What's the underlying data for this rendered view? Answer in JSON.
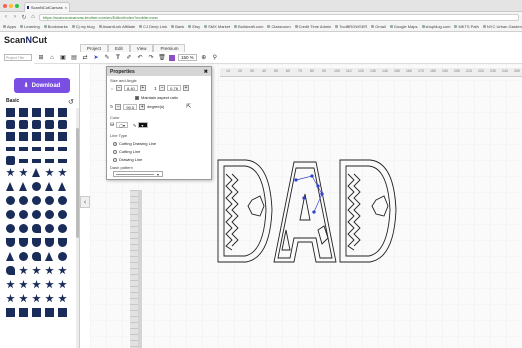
{
  "browser": {
    "tab_title": "ScanNCutCanvas",
    "tab_close": "×",
    "nav": {
      "back": "‹",
      "forward": "›",
      "reload": "↻",
      "home": "⌂"
    },
    "url": "https://scanncutcanvas.brother.com/en/Editor/Index?mobile=new",
    "bookmarks": [
      "Apps",
      "Learning",
      "Bookmarks",
      "Cj my blog",
      "AwardLink Affiliate",
      "CJ Deep Link",
      "Bank",
      "Etsy",
      "SMX Market",
      "Buildcraft.com",
      "Classroom",
      "Credit Time Admin",
      "ToolBROWSER",
      "Gmail",
      "Google Maps",
      "shopblog.com",
      "MKTS Path",
      "NYC Urban Garden",
      "Pandora Music"
    ]
  },
  "app": {
    "logo_text_1": "Scan",
    "logo_text_2": "N",
    "logo_text_3": "Cut",
    "project_placeholder": "Project Title",
    "menu_tabs": [
      "Project",
      "Edit",
      "View",
      "Premium"
    ],
    "zoom": "150 %",
    "download_label": "Download",
    "basic_label": "Basic"
  },
  "properties": {
    "title": "Properties",
    "size_angle_label": "Size and Angle",
    "width": "8.40",
    "height": "0.78",
    "maintain_label": "Maintain aspect ratio",
    "rotation": "90.5",
    "degree_label": "degree(s)",
    "color_label": "Color",
    "line_type_label": "Line Type",
    "line_options": [
      "Cutting Drawing Line",
      "Cutting Line",
      "Drawing Line"
    ],
    "dash_label": "Dash pattern"
  },
  "ruler_ticks": [
    "10",
    "20",
    "30",
    "40",
    "50",
    "60",
    "70",
    "80",
    "90",
    "100",
    "110",
    "120",
    "130",
    "140",
    "150",
    "160",
    "170",
    "180",
    "190",
    "200",
    "210",
    "220",
    "230",
    "240",
    "250"
  ],
  "canvas": {
    "design_text": "DAD"
  },
  "colors": {
    "accent": "#7a4ee3",
    "shape": "#1a2d5a",
    "selection": "#3344cc"
  }
}
